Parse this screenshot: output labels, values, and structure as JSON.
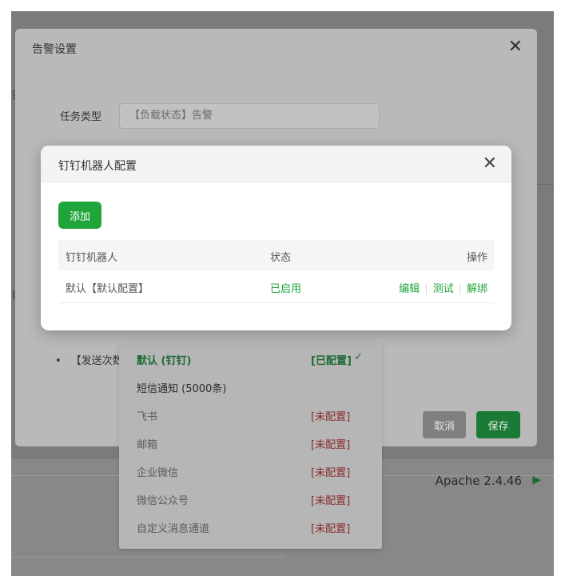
{
  "background": {
    "apache_label": "Apache 2.4.46",
    "play_icon": "play-triangle-icon",
    "side_letters": [
      "告",
      "自"
    ]
  },
  "outer_dialog": {
    "title": "告警设置",
    "close_icon": "close-icon",
    "task_type_label": "任务类型",
    "task_type_value": "【负载状态】告警",
    "bullet_text": "【发送次数",
    "cancel_label": "取消",
    "save_label": "保存"
  },
  "dropdown": {
    "items": [
      {
        "name": "默认 (钉钉)",
        "status": "[已配置]",
        "state": "selected"
      },
      {
        "name": "短信通知 (5000条)",
        "status": "",
        "state": "active"
      },
      {
        "name": "飞书",
        "status": "[未配置]",
        "state": "disabled"
      },
      {
        "name": "邮箱",
        "status": "[未配置]",
        "state": "disabled"
      },
      {
        "name": "企业微信",
        "status": "[未配置]",
        "state": "disabled"
      },
      {
        "name": "微信公众号",
        "status": "[未配置]",
        "state": "disabled"
      },
      {
        "name": "自定义消息通道",
        "status": "[未配置]",
        "state": "disabled"
      }
    ],
    "check_icon": "check-icon"
  },
  "modal": {
    "title": "钉钉机器人配置",
    "close_icon": "close-icon",
    "add_label": "添加",
    "columns": [
      "钉钉机器人",
      "状态",
      "操作"
    ],
    "rows": [
      {
        "name": "默认【默认配置】",
        "status": "已启用",
        "actions": [
          "编辑",
          "测试",
          "解绑"
        ]
      }
    ]
  },
  "colors": {
    "accent": "#20a53a",
    "unconfigured": "#8b2a2a"
  }
}
